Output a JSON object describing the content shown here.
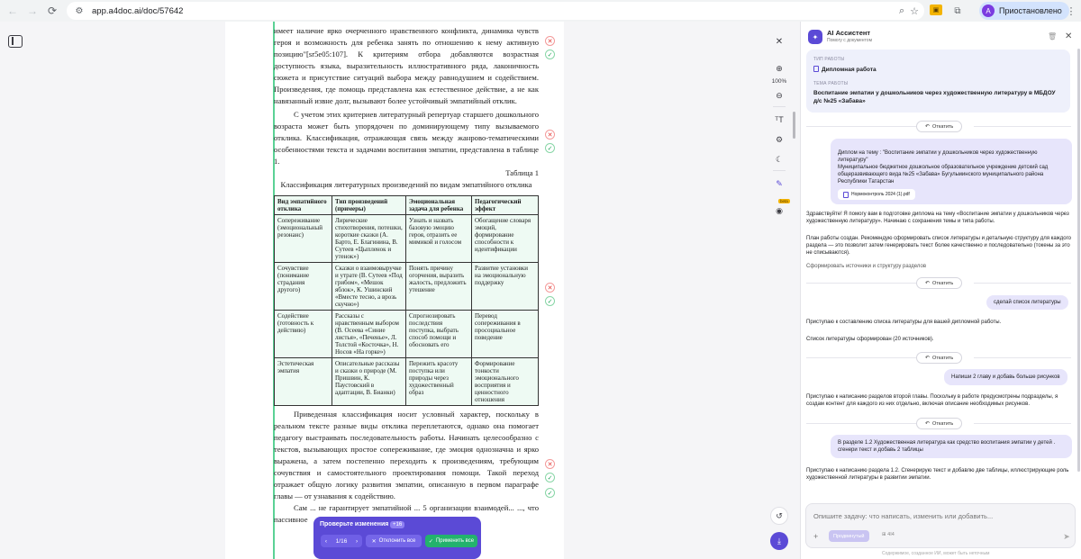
{
  "browser": {
    "url": "app.a4doc.ai/doc/57642",
    "profile_initial": "А",
    "profile_label": "Приостановлено"
  },
  "document": {
    "paragraphs_top": [
      "имеет наличие ярко очерченного нравственного конфликта, динамика чувств героя и возможность для ребенка занять по отношению к нему активную позицию\"[sr5e05:107]. К критериям отбора добавляются возрастная доступность языка, выразительность иллюстративного ряда, лаконичность сюжета и присутствие ситуаций выбора между равнодушием и содействием. Произведения, где помощь представлена как естественное действие, а не как навязанный извне долг, вызывают более устойчивый эмпатийный отклик.",
      "С учетом этих критериев литературный репертуар старшего дошкольного возраста может быть упорядочен по доминирующему типу вызываемого отклика. Классификация, отражающая связь между жанрово-тематическими особенностями текста и задачами воспитания эмпатии, представлена в таблице 1."
    ],
    "table_number": "Таблица 1",
    "table_title": "Классификация литературных произведений по видам эмпатийного отклика",
    "table": {
      "headers": [
        "Вид эмпатийного отклика",
        "Тип произведений (примеры)",
        "Эмоциональная задача для ребенка",
        "Педагогический эффект"
      ],
      "rows": [
        [
          "Сопереживание (эмоциональный резонанс)",
          "Лирические стихотворения, потешки, короткие сказки (А. Барто, Е. Благинина, В. Сутеев «Цыпленок и утенок»)",
          "Узнать и назвать базовую эмоцию героя, отразить ее мимикой и голосом",
          "Обогащение словаря эмоций, формирование способности к идентификации"
        ],
        [
          "Сочувствие (понимание страдания другого)",
          "Сказки о взаимовыручке и утрате (В. Сутеев «Под грибом», «Мешок яблок», К. Ушинский «Вместе тесно, а врозь скучно»)",
          "Понять причину огорчения, выразить жалость, предложить утешение",
          "Развитие установки на эмоциональную поддержку"
        ],
        [
          "Содействие (готовность к действию)",
          "Рассказы с нравственным выбором (В. Осеева «Синие листья», «Печенье», Л. Толстой «Косточка», Н. Носов «На горке»)",
          "Спрогнозировать последствия поступка, выбрать способ помощи и обосновать его",
          "Перевод сопереживания в просоциальное поведение"
        ],
        [
          "Эстетическая эмпатия",
          "Описательные рассказы и сказки о природе (М. Пришвин, К. Паустовский в адаптации, В. Бианки)",
          "Пережить красоту поступка или природы через художественный образ",
          "Формирование тонкости эмоционального восприятия и ценностного отношения"
        ]
      ]
    },
    "paragraphs_bottom": [
      "Приведенная классификация носит условный характер, поскольку в реальном тексте разные виды отклика переплетаются, однако она помогает педагогу выстраивать последовательность работы. Начинать целесообразно с текстов, вызывающих простое сопереживание, где эмоция однозначна и ярко выражена, а затем постепенно переходить к произведениям, требующим сочувствия и самостоятельного проектирования помощи. Такой переход отражает общую логику развития эмпатии, описанную в первом параграфе главы — от узнавания к содействию.",
      "Сам ... не гарантирует эмпатийной ... 5 организации взаимодей... ..., что пассивное"
    ]
  },
  "review_bar": {
    "title": "Проверьте изменения",
    "badge": "+16",
    "pager": "1/16",
    "reject_label": "Отклонить все",
    "accept_label": "Применить все"
  },
  "tools": {
    "zoom": "100%",
    "beta": "beta"
  },
  "assistant": {
    "title": "AI Ассистент",
    "subtitle": "Помогу с документом",
    "card": {
      "type_label": "ТИП РАБОТЫ",
      "type_value": "Дипломная работа",
      "topic_label": "ТЕМА РАБОТЫ",
      "topic_value": "Воспитание эмпатии у дошкольников через художественную литературу в МБДОУ д/с №25 «Забава»"
    },
    "revert_label": "Откатить",
    "msg_user_1": "Диплом на тему : \"Воспитание эмпатии у дошкольников через художественную литературу\"\nМуниципальное бюджетное дошкольное образовательное учреждение детский сад общеразвивающего вида №25 «Забава» Бугульминского муниципального района Республики Татарстан",
    "attachment": "Нормоконтроль 2024 (1).pdf",
    "msg_bot_1a": "Здравствуйте! Я помогу вам в подготовке диплома на тему «Воспитание эмпатии у дошкольников через художественную литературу». Начинаю с сохранения темы и типа работы.",
    "msg_bot_1b": "План работы создан. Рекомендую сформировать список литературы и детальную структуру для каждого раздела — это позволит затем генерировать текст более качественно и последовательно (токены за это не списываются).",
    "msg_bot_1c": "Сформировать источники и структуру разделов",
    "msg_user_2": "сделай список литературы",
    "msg_bot_2a": "Приступаю к составлению списка литературы для вашей дипломной работы.",
    "msg_bot_2b": "Список литературы сформирован (20 источников).",
    "msg_user_3": "Напиши 2 главу и добавь больше рисунков",
    "msg_bot_3": "Приступаю к написанию разделов второй главы. Поскольку в работе предусмотрены подразделы, я создам контент для каждого из них отдельно, включая описание необходимых рисунков.",
    "msg_user_4": "В разделе 1.2 Художественная литература как средство воспитания эмпатии у детей . сгенери текст и добавь 2 таблицы",
    "msg_bot_4": "Приступаю к написанию раздела 1.2. Сгенерирую текст и добавлю две таблицы, иллюстрирующие роль художественной литературы в развитии эмпатии.",
    "input_placeholder": "Опишите задачу: что написать, изменить или добавить...",
    "think_label": "Продвинутый",
    "model_label": "⊞ 4I4",
    "footer": "Содержимое, созданное ИИ, может быть неточным"
  }
}
